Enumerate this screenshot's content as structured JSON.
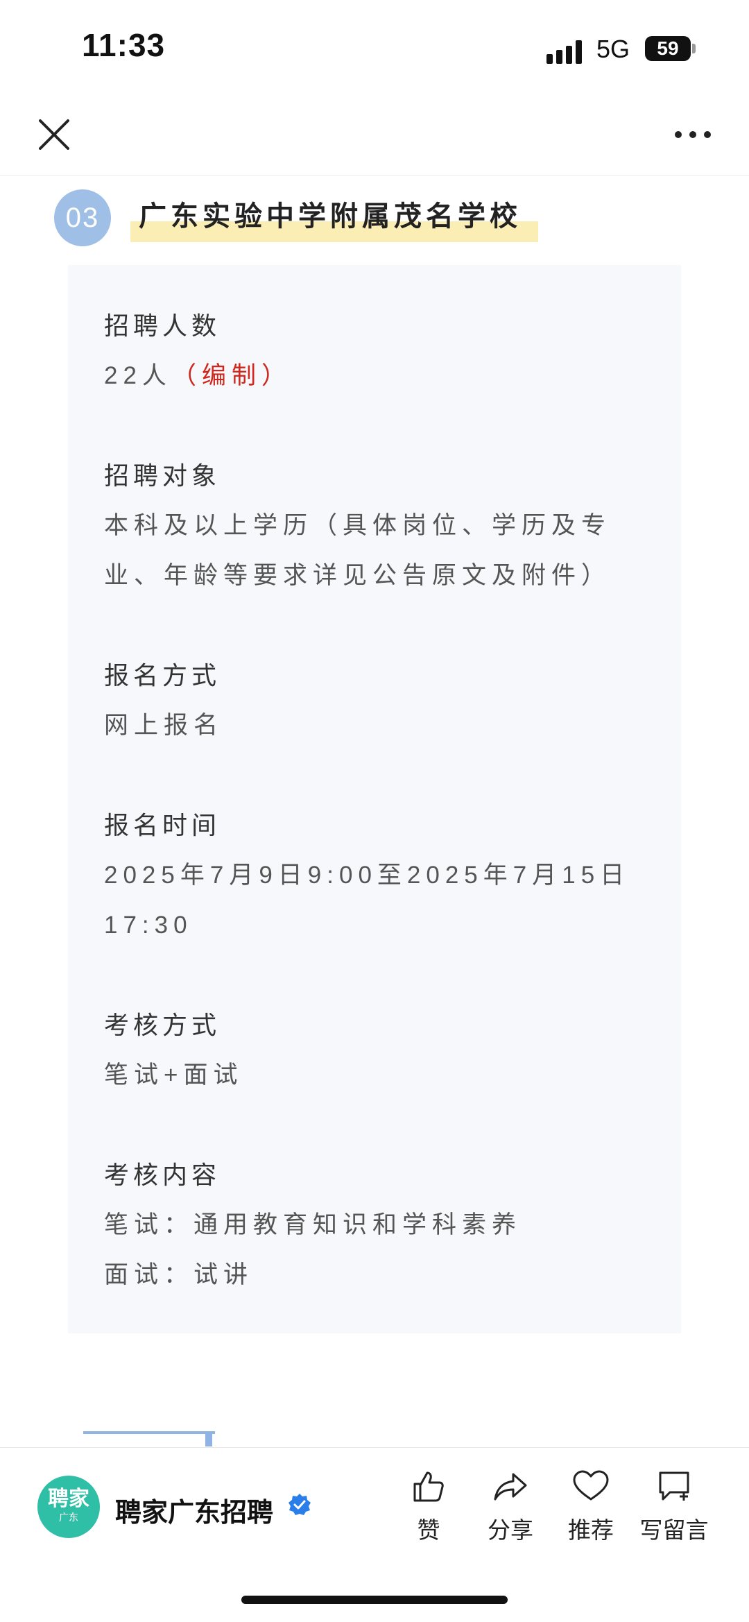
{
  "status_bar": {
    "time": "11:33",
    "network": "5G",
    "battery": "59"
  },
  "header": {
    "close_icon": "close-icon",
    "more_icon": "more-icon"
  },
  "section": {
    "number": "03",
    "title": "广东实验中学附属茂名学校"
  },
  "details": {
    "count_label": "招聘人数",
    "count_value": "22人",
    "count_note": "（编制）",
    "target_label": "招聘对象",
    "target_value_line1": "本科及以上学历（具体岗位、学历及专",
    "target_value_line2": "业、年龄等要求详见公告原文及附件）",
    "method_label": "报名方式",
    "method_value": "网上报名",
    "time_label": "报名时间",
    "time_value_line1": "2025年7月9日9:00至2025年7月15日",
    "time_value_line2": "17:30",
    "exam_label": "考核方式",
    "exam_value": "笔试+面试",
    "content_label": "考核内容",
    "content_line1": "笔试：通用教育知识和学科素养",
    "content_line2": "面试：试讲"
  },
  "bottom_bar": {
    "logo_text": "聘家",
    "logo_sub": "广东",
    "account_name": "聘家广东招聘",
    "actions": [
      {
        "label": "赞",
        "icon": "thumbs-up-icon"
      },
      {
        "label": "分享",
        "icon": "share-icon"
      },
      {
        "label": "推荐",
        "icon": "heart-icon"
      },
      {
        "label": "写留言",
        "icon": "comment-icon"
      }
    ]
  },
  "colors": {
    "accent_red": "#d0261c",
    "badge_blue": "#9fbfe6",
    "highlight_yellow": "#fbeeb4",
    "logo_green": "#2fbfa6"
  }
}
